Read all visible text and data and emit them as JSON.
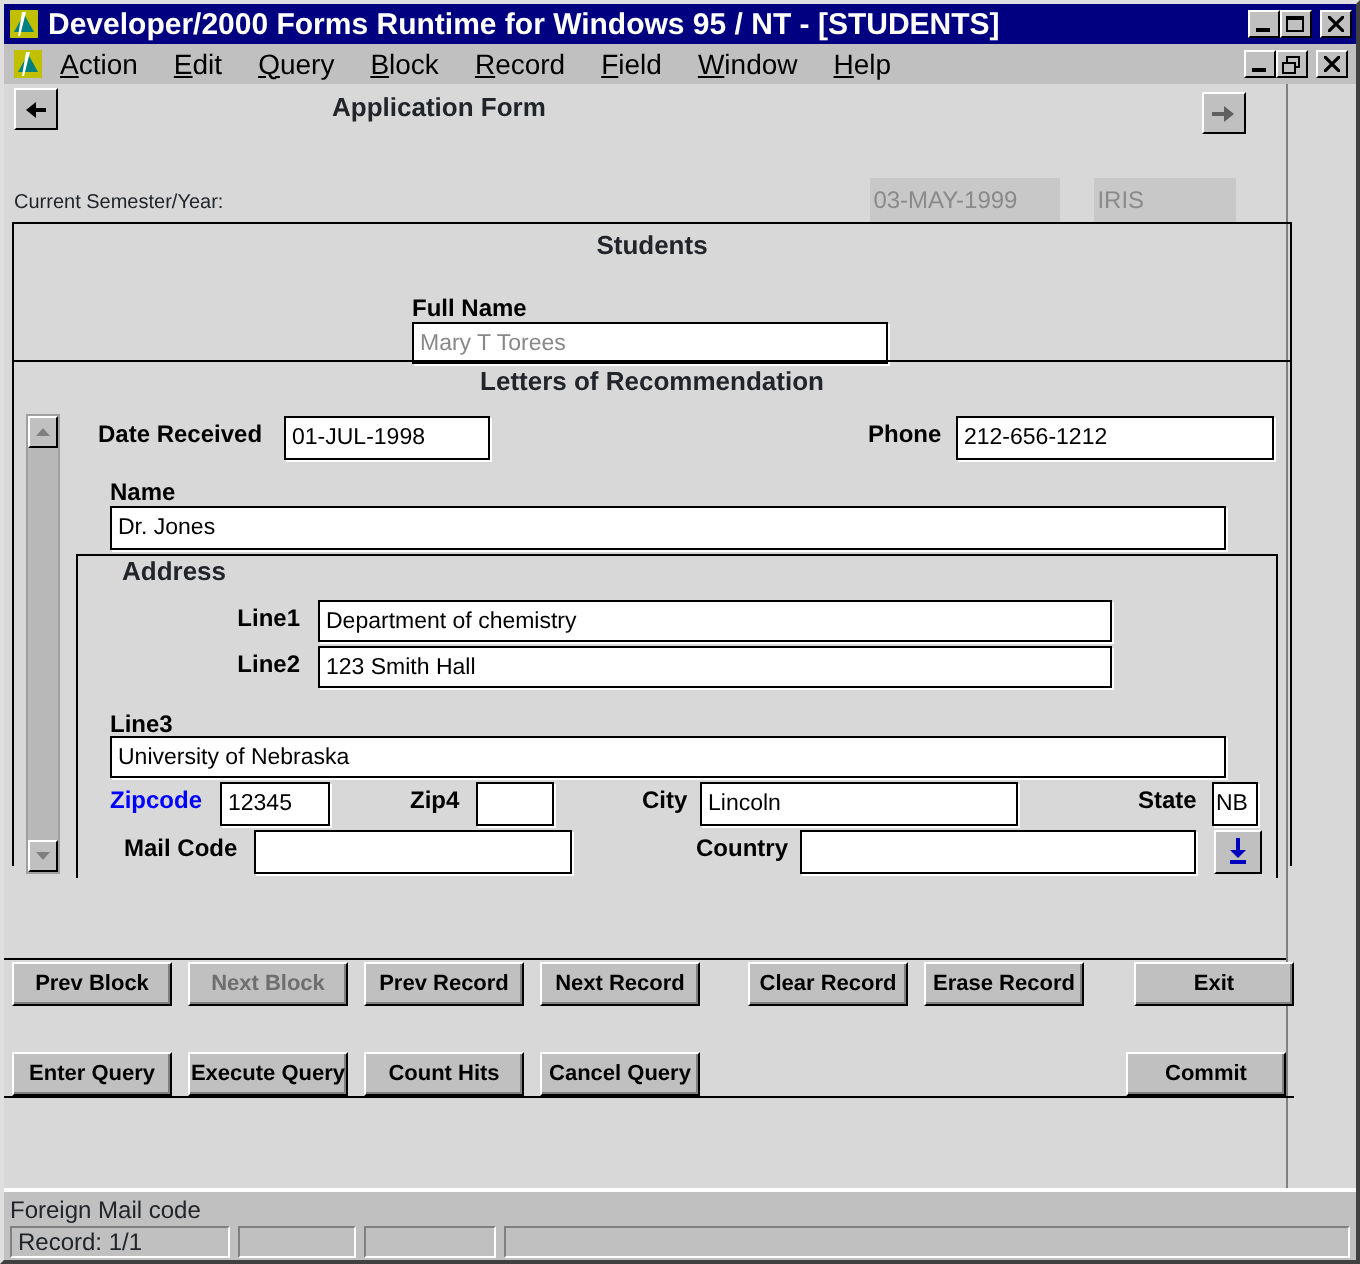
{
  "window": {
    "title": "Developer/2000 Forms Runtime for Windows 95 / NT - [STUDENTS]"
  },
  "menu": [
    "Action",
    "Edit",
    "Query",
    "Block",
    "Record",
    "Field",
    "Window",
    "Help"
  ],
  "form": {
    "title": "Application Form",
    "semester_label": "Current Semester/Year:",
    "semester_date": "03-MAY-1999",
    "semester_user": "IRIS"
  },
  "students": {
    "title": "Students",
    "full_name": {
      "label": "Full Name",
      "value": "Mary T Torees",
      "disabled": true
    }
  },
  "letters": {
    "title": "Letters of Recommendation",
    "date_received": {
      "label": "Date Received",
      "value": "01-JUL-1998"
    },
    "phone": {
      "label": "Phone",
      "value": "212-656-1212"
    },
    "name": {
      "label": "Name",
      "value": "Dr. Jones"
    },
    "address": {
      "title": "Address",
      "fields": [
        {
          "label": "Line1",
          "value": "Department of chemistry",
          "highlighted": false
        },
        {
          "label": "Line2",
          "value": "123 Smith Hall",
          "highlighted": false
        },
        {
          "label": "Line3",
          "value": "University of Nebraska",
          "highlighted": false
        },
        {
          "label": "Zipcode",
          "value": "12345",
          "highlighted": true
        },
        {
          "label": "Zip4",
          "highlighted": false
        },
        {
          "label": "City",
          "value": "Lincoln",
          "highlighted": false
        },
        {
          "label": "State",
          "value": "NB",
          "highlighted": false
        },
        {
          "label": "Mail Code",
          "highlighted": false
        },
        {
          "label": "Country",
          "highlighted": false
        }
      ]
    }
  },
  "button_rows": [
    [
      [
        {
          "label": "Prev Block",
          "disabled": false
        },
        {
          "label": "Next Block",
          "disabled": true
        },
        {
          "label": "Prev Record",
          "disabled": false
        },
        {
          "label": "Next Record",
          "disabled": false
        }
      ],
      [
        {
          "label": "Clear Record",
          "disabled": false
        },
        {
          "label": "Erase Record",
          "disabled": false
        }
      ],
      [
        {
          "label": "Exit",
          "disabled": false
        }
      ]
    ],
    [
      [
        {
          "label": "Enter Query",
          "disabled": false
        },
        {
          "label": "Execute Query",
          "disabled": false
        },
        {
          "label": "Count Hits",
          "disabled": false
        },
        {
          "label": "Cancel Query",
          "disabled": false
        }
      ],
      [
        {
          "label": "Commit",
          "disabled": false
        }
      ]
    ]
  ],
  "status_bar": {
    "message": "Foreign Mail code",
    "record": "Record: 1/1"
  }
}
